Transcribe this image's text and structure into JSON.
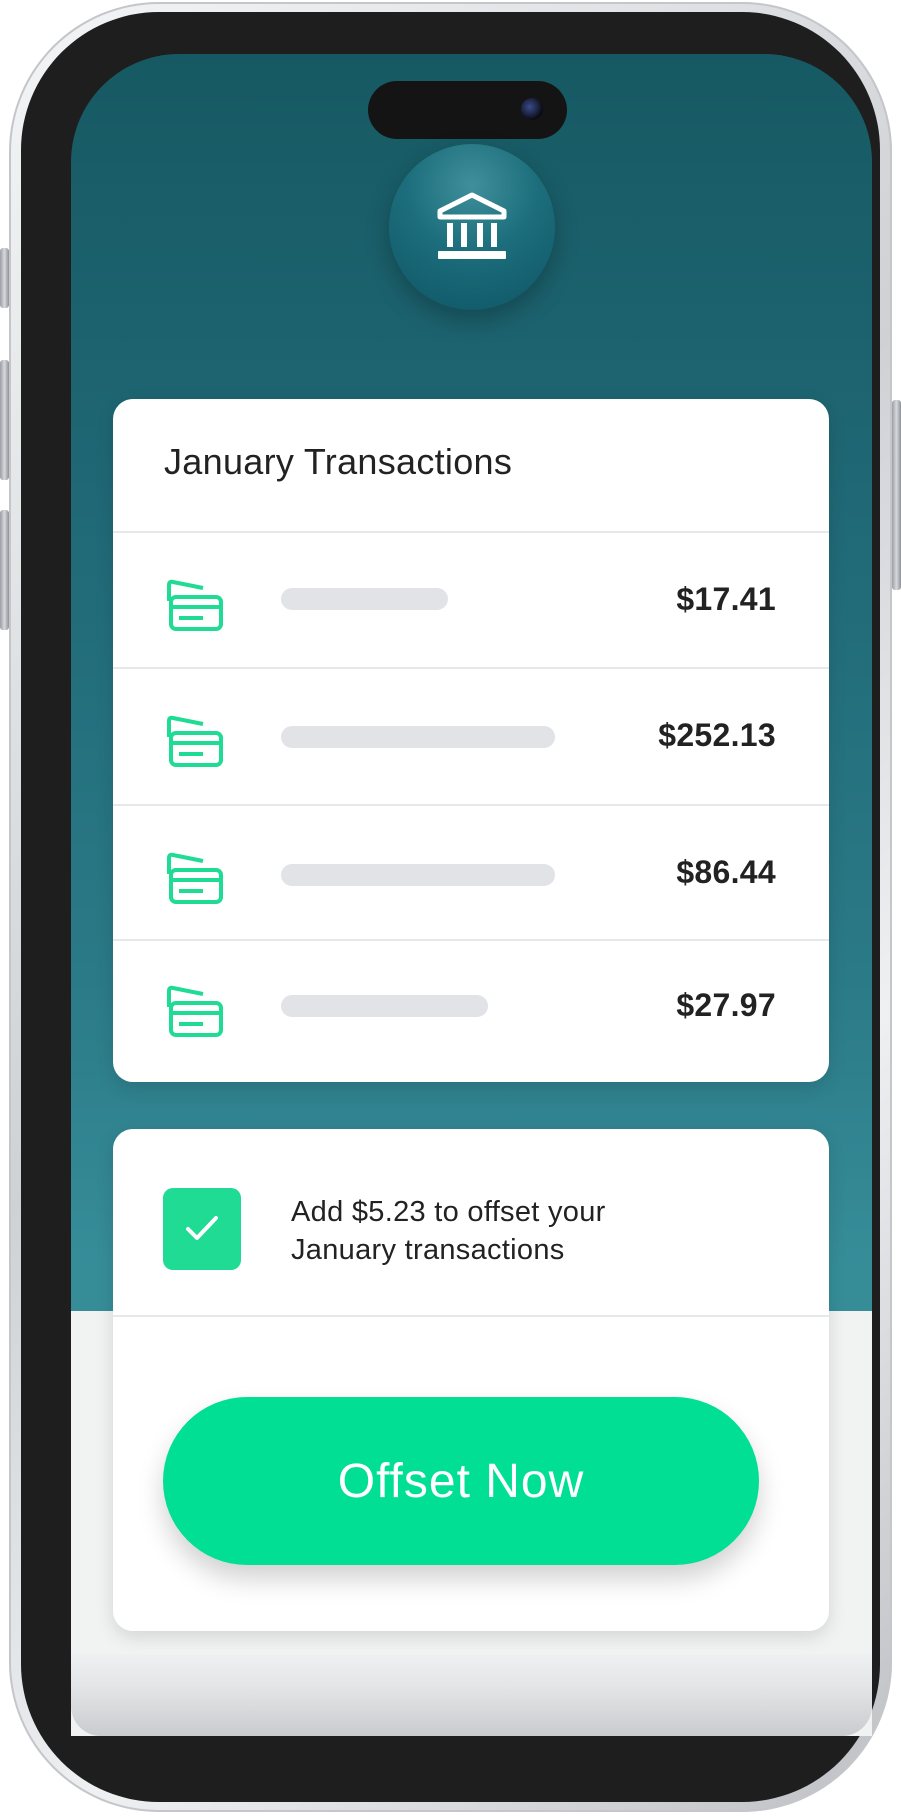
{
  "app": {
    "header_icon": "bank-icon"
  },
  "transactions": {
    "title": "January Transactions",
    "row_icon": "credit-card-icon",
    "rows": [
      {
        "amount": "$17.41"
      },
      {
        "amount": "$252.13"
      },
      {
        "amount": "$86.44"
      },
      {
        "amount": "$27.97"
      }
    ]
  },
  "offset": {
    "checked": true,
    "line1": "Add $5.23 to offset your",
    "line2": "January transactions",
    "button_label": "Offset Now"
  },
  "colors": {
    "accent_green": "#00df94",
    "icon_green": "#1fdb94",
    "header_teal": "#165963"
  }
}
